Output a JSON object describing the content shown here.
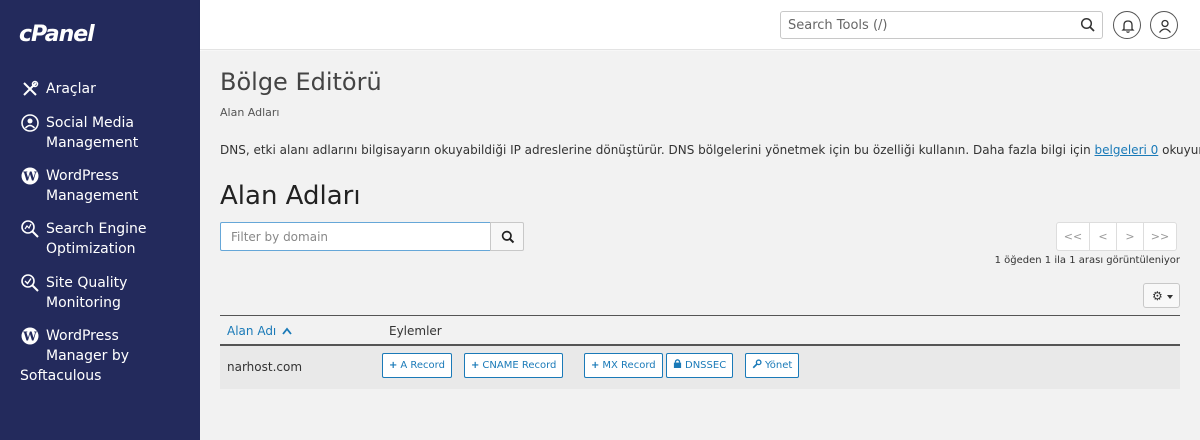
{
  "app": {
    "logo_text": "cPanel"
  },
  "sidebar": {
    "items": [
      {
        "label": "Araçlar",
        "icon": "tools-icon"
      },
      {
        "label_l1": "Social Media",
        "label_l2": "Management",
        "icon": "social-media-icon"
      },
      {
        "label_l1": "WordPress",
        "label_l2": "Management",
        "icon": "wordpress-icon"
      },
      {
        "label_l1": "Search Engine",
        "label_l2": "Optimization",
        "icon": "seo-icon"
      },
      {
        "label_l1": "Site Quality",
        "label_l2": "Monitoring",
        "icon": "site-quality-icon"
      },
      {
        "label_l1": "WordPress",
        "label_l2": "Manager by",
        "label_l3": "Softaculous",
        "icon": "wordpress-icon"
      }
    ]
  },
  "header": {
    "search": {
      "placeholder": "Search Tools (/)"
    },
    "icons": [
      "bell-icon",
      "user-icon"
    ]
  },
  "main": {
    "title": "Bölge Editörü",
    "breadcrumb": "Alan Adları",
    "description_before": "DNS, etki alanı adlarını bilgisayarın okuyabildiği IP adreslerine dönüştürür. DNS bölgelerini yönetmek için bu özelliği kullanın. Daha fazla bilgi için ",
    "description_link": "belgeleri 0",
    "description_after": " okuyun.",
    "section_title": "Alan Adları",
    "filter": {
      "placeholder": "Filter by domain"
    },
    "pager": {
      "first": "<<",
      "prev": "<",
      "next": ">",
      "last": ">>"
    },
    "showing_text": "1 öğeden 1 ila 1 arası görüntüleniyor",
    "table": {
      "columns": {
        "domain": "Alan Adı",
        "actions": "Eylemler"
      },
      "rows": [
        {
          "domain": "narhost.com",
          "actions": [
            {
              "icon": "+",
              "label": "A Record"
            },
            {
              "icon": "+",
              "label": "CNAME Record"
            },
            {
              "icon": "+",
              "label": "MX Record"
            },
            {
              "icon": "lock",
              "label": "DNSSEC"
            },
            {
              "icon": "wrench",
              "label": "Yönet"
            }
          ]
        }
      ]
    }
  },
  "colors": {
    "sidebar_bg": "#232a5c",
    "link": "#1a7ab8",
    "main_bg": "#f2f2f2"
  }
}
